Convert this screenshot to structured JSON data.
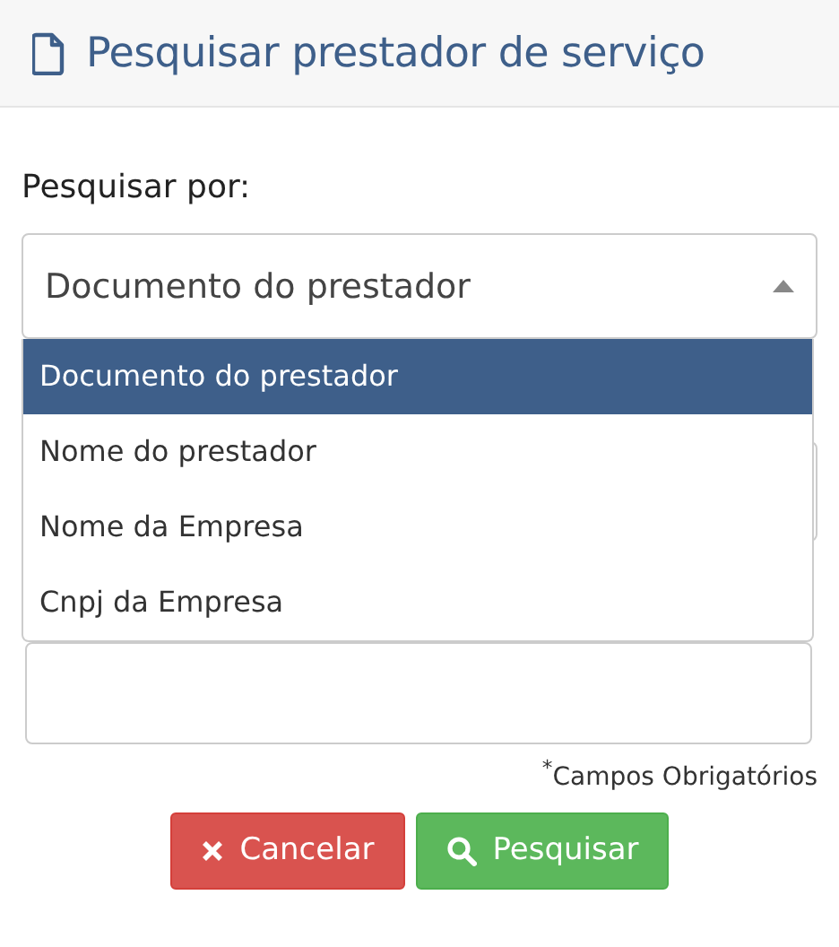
{
  "header": {
    "title": "Pesquisar prestador de serviço"
  },
  "search_by": {
    "label": "Pesquisar por:",
    "value": "Documento do prestador",
    "expanded": true,
    "options": [
      {
        "label": "Documento do prestador",
        "selected": true
      },
      {
        "label": "Nome do prestador",
        "selected": false
      },
      {
        "label": "Nome da Empresa",
        "selected": false
      },
      {
        "label": "Cnpj da Empresa",
        "selected": false
      }
    ]
  },
  "note": "$^{*}$Campos Obrigatórios",
  "buttons": [
    {
      "kind": "cancel",
      "label": "Cancelar"
    },
    {
      "kind": "search",
      "label": "Pesquisar"
    }
  ]
}
